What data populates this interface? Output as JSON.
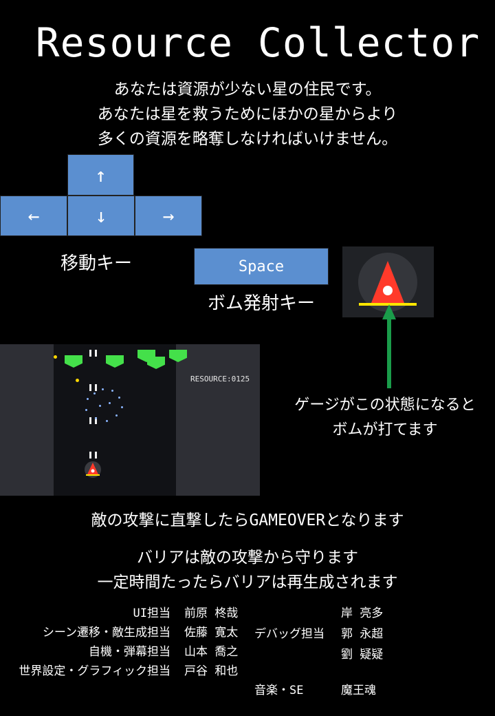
{
  "title": "Resource Collector",
  "intro": [
    "あなたは資源が少ない星の住民です。",
    "あなたは星を救うためにほかの星からより",
    "多くの資源を略奪しなければいけません。"
  ],
  "keys": {
    "up": "↑",
    "left": "←",
    "down": "↓",
    "right": "→",
    "move_label": "移動キー",
    "space": "Space",
    "bomb_label": "ボム発射キー"
  },
  "gauge_note": [
    "ゲージがこの状態になると",
    "ボムが打てます"
  ],
  "game": {
    "resource": "RESOURCE:0125"
  },
  "notes": [
    "敵の攻撃に直撃したらGAMEOVERとなります",
    "バリアは敵の攻撃から守ります",
    "一定時間たったらバリアは再生成されます"
  ],
  "credits": {
    "left": [
      {
        "role": "UI担当",
        "name": "前原 柊哉"
      },
      {
        "role": "シーン遷移・敵生成担当",
        "name": "佐藤 寛太"
      },
      {
        "role": "自機・弾幕担当",
        "name": "山本 喬之"
      },
      {
        "role": "世界設定・グラフィック担当",
        "name": "戸谷 和也"
      }
    ],
    "debug_role": "デバッグ担当",
    "debug_names": [
      "岸 亮多",
      "郭 永超",
      "劉 疑疑"
    ],
    "music_role": "音楽・SE",
    "music_name": "魔王魂"
  },
  "colors": {
    "key_blue": "#5b8fd0",
    "arrow_green": "#1a9c4a",
    "bomb_red": "#ff3a2a",
    "gauge_yellow": "#ffe600",
    "enemy_green": "#44e04a"
  }
}
